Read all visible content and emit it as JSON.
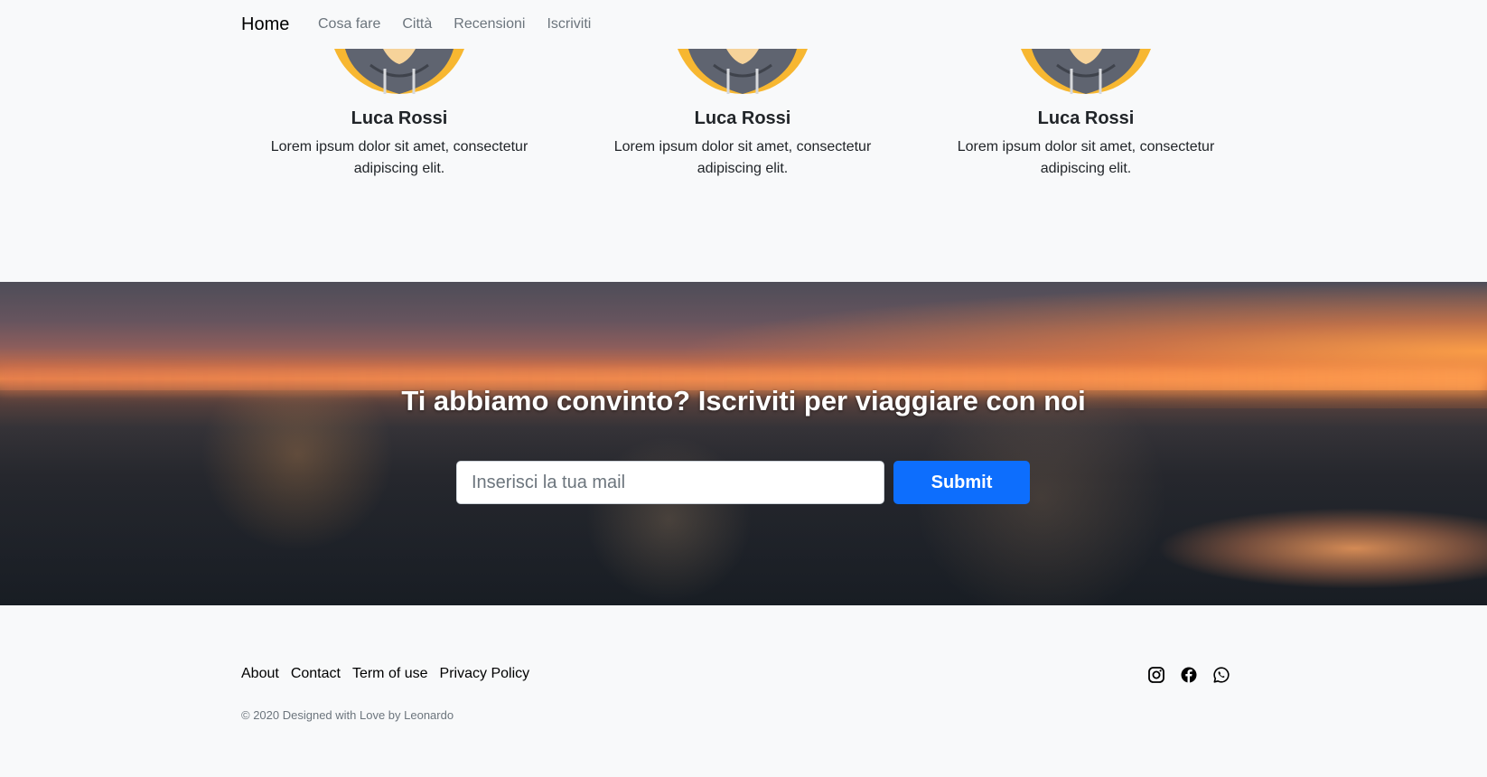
{
  "nav": {
    "brand": "Home",
    "links": [
      "Cosa fare",
      "Città",
      "Recensioni",
      "Iscriviti"
    ]
  },
  "team": {
    "members": [
      {
        "name": "Luca Rossi",
        "description": "Lorem ipsum dolor sit amet, consectetur adipiscing elit."
      },
      {
        "name": "Luca Rossi",
        "description": "Lorem ipsum dolor sit amet, consectetur adipiscing elit."
      },
      {
        "name": "Luca Rossi",
        "description": "Lorem ipsum dolor sit amet, consectetur adipiscing elit."
      }
    ]
  },
  "subscribe": {
    "title": "Ti abbiamo convinto? Iscriviti per viaggiare con noi",
    "email_placeholder": "Inserisci la tua mail",
    "email_value": "",
    "submit_label": "Submit"
  },
  "footer": {
    "links": [
      "About",
      "Contact",
      "Term of use",
      "Privacy Policy"
    ],
    "copyright": "© 2020 Designed with Love by Leonardo",
    "socials": [
      "instagram-icon",
      "facebook-icon",
      "whatsapp-icon"
    ]
  },
  "colors": {
    "primary": "#0d6efd",
    "background": "#f8f9fa",
    "muted": "#6c757d",
    "avatar_body": "#5f6470",
    "avatar_accent": "#f7b731",
    "avatar_skin": "#f6d39a"
  }
}
